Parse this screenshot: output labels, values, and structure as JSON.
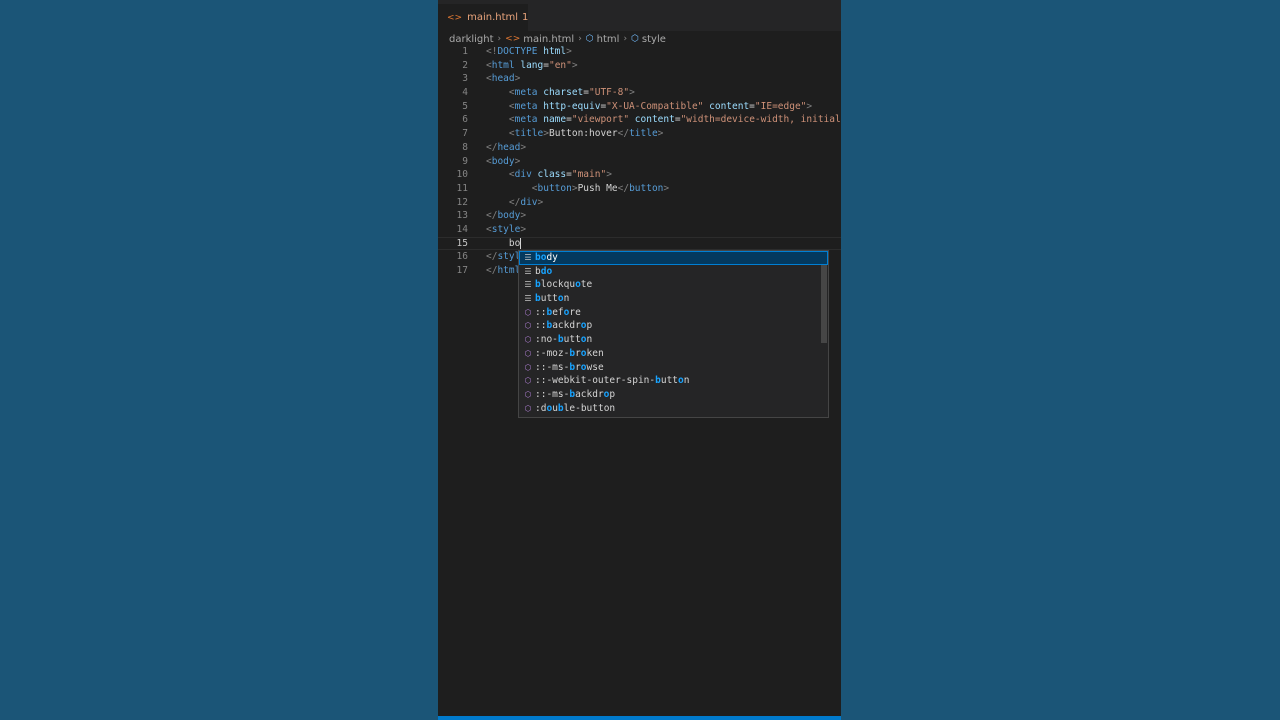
{
  "tab": {
    "label": "main.html",
    "problems": "1"
  },
  "breadcrumb": {
    "folder": "darklight",
    "file": "main.html",
    "node1": "html",
    "node2": "style"
  },
  "lines": [
    {
      "n": "1",
      "tokens": [
        {
          "c": "t",
          "v": "<!"
        },
        {
          "c": "tag",
          "v": "DOCTYPE"
        },
        {
          "c": "at",
          "v": " html"
        },
        {
          "c": "t",
          "v": ">"
        }
      ]
    },
    {
      "n": "2",
      "tokens": [
        {
          "c": "t",
          "v": "<"
        },
        {
          "c": "tag",
          "v": "html"
        },
        {
          "c": "at",
          "v": " lang"
        },
        {
          "c": "x",
          "v": "="
        },
        {
          "c": "s",
          "v": "\"en\""
        },
        {
          "c": "t",
          "v": ">"
        }
      ]
    },
    {
      "n": "3",
      "tokens": [
        {
          "c": "t",
          "v": "<"
        },
        {
          "c": "tag",
          "v": "head"
        },
        {
          "c": "t",
          "v": ">"
        }
      ]
    },
    {
      "n": "4",
      "tokens": [
        {
          "c": "x",
          "v": "    "
        },
        {
          "c": "t",
          "v": "<"
        },
        {
          "c": "tag",
          "v": "meta"
        },
        {
          "c": "at",
          "v": " charset"
        },
        {
          "c": "x",
          "v": "="
        },
        {
          "c": "s",
          "v": "\"UTF-8\""
        },
        {
          "c": "t",
          "v": ">"
        }
      ]
    },
    {
      "n": "5",
      "tokens": [
        {
          "c": "x",
          "v": "    "
        },
        {
          "c": "t",
          "v": "<"
        },
        {
          "c": "tag",
          "v": "meta"
        },
        {
          "c": "at",
          "v": " http-equiv"
        },
        {
          "c": "x",
          "v": "="
        },
        {
          "c": "s",
          "v": "\"X-UA-Compatible\""
        },
        {
          "c": "at",
          "v": " content"
        },
        {
          "c": "x",
          "v": "="
        },
        {
          "c": "s",
          "v": "\"IE=edge\""
        },
        {
          "c": "t",
          "v": ">"
        }
      ]
    },
    {
      "n": "6",
      "tokens": [
        {
          "c": "x",
          "v": "    "
        },
        {
          "c": "t",
          "v": "<"
        },
        {
          "c": "tag",
          "v": "meta"
        },
        {
          "c": "at",
          "v": " name"
        },
        {
          "c": "x",
          "v": "="
        },
        {
          "c": "s",
          "v": "\"viewport\""
        },
        {
          "c": "at",
          "v": " content"
        },
        {
          "c": "x",
          "v": "="
        },
        {
          "c": "s",
          "v": "\"width=device-width, initial-s"
        }
      ]
    },
    {
      "n": "7",
      "tokens": [
        {
          "c": "x",
          "v": "    "
        },
        {
          "c": "t",
          "v": "<"
        },
        {
          "c": "tag",
          "v": "title"
        },
        {
          "c": "t",
          "v": ">"
        },
        {
          "c": "x",
          "v": "Button:hover"
        },
        {
          "c": "t",
          "v": "</"
        },
        {
          "c": "tag",
          "v": "title"
        },
        {
          "c": "t",
          "v": ">"
        }
      ]
    },
    {
      "n": "8",
      "tokens": [
        {
          "c": "t",
          "v": "</"
        },
        {
          "c": "tag",
          "v": "head"
        },
        {
          "c": "t",
          "v": ">"
        }
      ]
    },
    {
      "n": "9",
      "tokens": [
        {
          "c": "t",
          "v": "<"
        },
        {
          "c": "tag",
          "v": "body"
        },
        {
          "c": "t",
          "v": ">"
        }
      ]
    },
    {
      "n": "10",
      "tokens": [
        {
          "c": "x",
          "v": "    "
        },
        {
          "c": "t",
          "v": "<"
        },
        {
          "c": "tag",
          "v": "div"
        },
        {
          "c": "at",
          "v": " class"
        },
        {
          "c": "x",
          "v": "="
        },
        {
          "c": "s",
          "v": "\"main\""
        },
        {
          "c": "t",
          "v": ">"
        }
      ]
    },
    {
      "n": "11",
      "tokens": [
        {
          "c": "x",
          "v": "        "
        },
        {
          "c": "t",
          "v": "<"
        },
        {
          "c": "tag",
          "v": "button"
        },
        {
          "c": "t",
          "v": ">"
        },
        {
          "c": "x",
          "v": "Push Me"
        },
        {
          "c": "t",
          "v": "</"
        },
        {
          "c": "tag",
          "v": "button"
        },
        {
          "c": "t",
          "v": ">"
        }
      ]
    },
    {
      "n": "12",
      "tokens": [
        {
          "c": "x",
          "v": "    "
        },
        {
          "c": "t",
          "v": "</"
        },
        {
          "c": "tag",
          "v": "div"
        },
        {
          "c": "t",
          "v": ">"
        }
      ]
    },
    {
      "n": "13",
      "tokens": [
        {
          "c": "t",
          "v": "</"
        },
        {
          "c": "tag",
          "v": "body"
        },
        {
          "c": "t",
          "v": ">"
        }
      ]
    },
    {
      "n": "14",
      "tokens": [
        {
          "c": "t",
          "v": "<"
        },
        {
          "c": "tag",
          "v": "style"
        },
        {
          "c": "t",
          "v": ">"
        }
      ]
    },
    {
      "n": "15",
      "current": true,
      "tokens": [
        {
          "c": "x",
          "v": "    bo"
        }
      ]
    },
    {
      "n": "16",
      "tokens": [
        {
          "c": "t",
          "v": "</"
        },
        {
          "c": "tag",
          "v": "styl"
        }
      ]
    },
    {
      "n": "17",
      "tokens": [
        {
          "c": "t",
          "v": "</"
        },
        {
          "c": "tag",
          "v": "html"
        }
      ]
    }
  ],
  "suggestions": [
    {
      "kind": "kw",
      "pre": "",
      "hl": "bo",
      "post": "dy",
      "selected": true
    },
    {
      "kind": "kw",
      "pre": "b",
      "hl": "do",
      "post": ""
    },
    {
      "kind": "kw",
      "pre": "",
      "hl": "b",
      "post": "lockqu",
      "hl2": "o",
      "post2": "te"
    },
    {
      "kind": "kw",
      "pre": "",
      "hl": "b",
      "post": "utt",
      "hl2": "o",
      "post2": "n"
    },
    {
      "kind": "prop",
      "pre": "::",
      "hl": "b",
      "post": "ef",
      "hl2": "o",
      "post2": "re"
    },
    {
      "kind": "prop",
      "pre": "::",
      "hl": "b",
      "post": "ackdr",
      "hl2": "o",
      "post2": "p"
    },
    {
      "kind": "prop",
      "pre": ":no-",
      "hl": "b",
      "post": "utt",
      "hl2": "o",
      "post2": "n"
    },
    {
      "kind": "prop",
      "pre": ":-moz-",
      "hl": "b",
      "post": "r",
      "hl2": "o",
      "post2": "ken"
    },
    {
      "kind": "prop",
      "pre": "::-ms-",
      "hl": "b",
      "post": "r",
      "hl2": "o",
      "post2": "wse"
    },
    {
      "kind": "prop",
      "pre": "::-webkit-outer-spin-",
      "hl": "b",
      "post": "utt",
      "hl2": "o",
      "post2": "n"
    },
    {
      "kind": "prop",
      "pre": "::-ms-",
      "hl": "b",
      "post": "ackdr",
      "hl2": "o",
      "post2": "p"
    },
    {
      "kind": "prop",
      "pre": ":d",
      "hl": "o",
      "post": "u",
      "hl2": "b",
      "post2": "le-button"
    }
  ]
}
